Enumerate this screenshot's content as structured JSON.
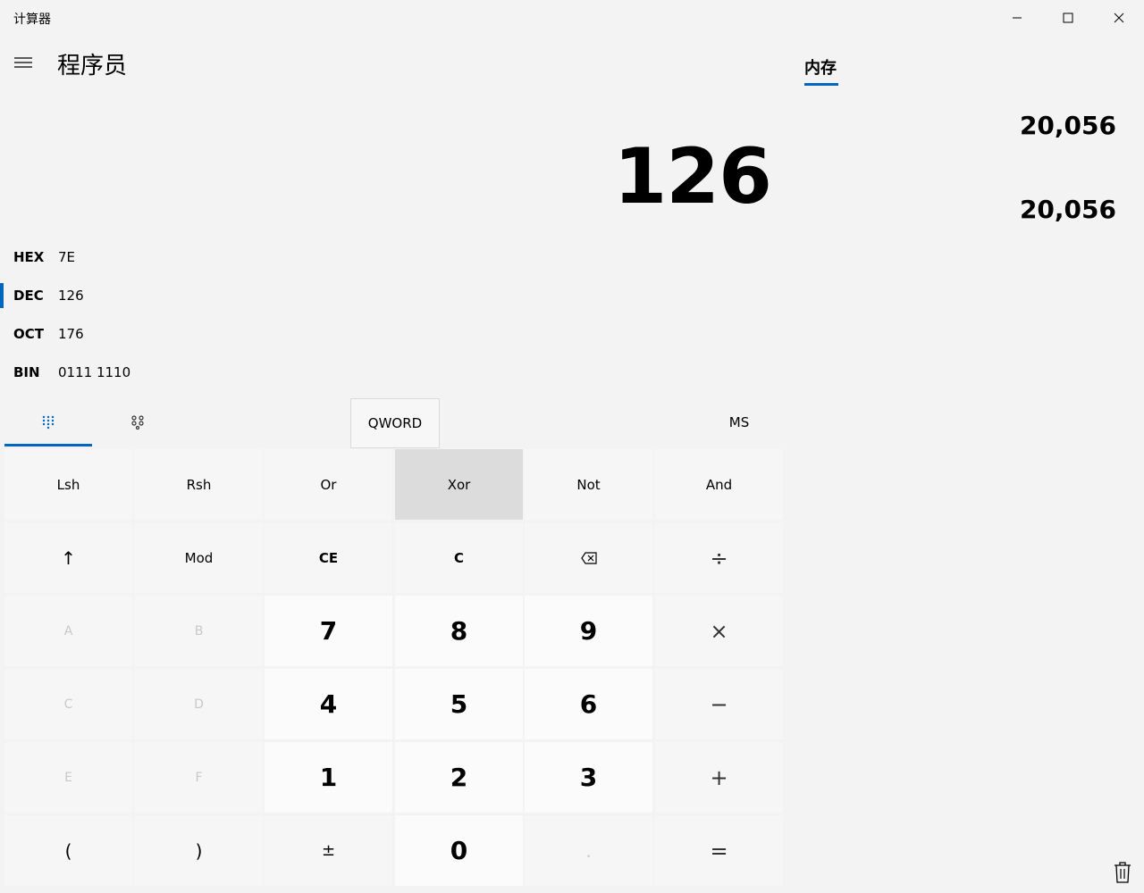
{
  "window": {
    "app_title": "计算器"
  },
  "header": {
    "mode_title": "程序员"
  },
  "display": {
    "value": "126"
  },
  "radix": [
    {
      "label": "HEX",
      "value": "7E",
      "active": false
    },
    {
      "label": "DEC",
      "value": "126",
      "active": true
    },
    {
      "label": "OCT",
      "value": "176",
      "active": false
    },
    {
      "label": "BIN",
      "value": "0111 1110",
      "active": false
    }
  ],
  "toolbar": {
    "word_size": "QWORD",
    "memory_store": "MS"
  },
  "keys": {
    "lsh": "Lsh",
    "rsh": "Rsh",
    "or": "Or",
    "xor": "Xor",
    "not": "Not",
    "and": "And",
    "shift": "↑",
    "mod": "Mod",
    "ce": "CE",
    "c": "C",
    "divide": "÷",
    "a": "A",
    "b": "B",
    "seven": "7",
    "eight": "8",
    "nine": "9",
    "multiply": "×",
    "c_hex": "C",
    "d": "D",
    "four": "4",
    "five": "5",
    "six": "6",
    "minus": "−",
    "e": "E",
    "f": "F",
    "one": "1",
    "two": "2",
    "three": "3",
    "plus": "+",
    "open_paren": "(",
    "close_paren": ")",
    "negate": "±",
    "zero": "0",
    "decimal": ".",
    "equals": "="
  },
  "memory": {
    "tab_label": "内存",
    "items": [
      "20,056",
      "20,056"
    ]
  },
  "colors": {
    "accent": "#0067c0",
    "background": "#f3f3f3"
  },
  "icons": {
    "menu": "hamburger-icon",
    "minimize": "minimize-icon",
    "maximize": "maximize-icon",
    "close": "close-icon",
    "keypad": "keypad-icon",
    "bitwise": "bitwise-icon",
    "backspace": "backspace-icon",
    "trash": "trash-icon"
  }
}
